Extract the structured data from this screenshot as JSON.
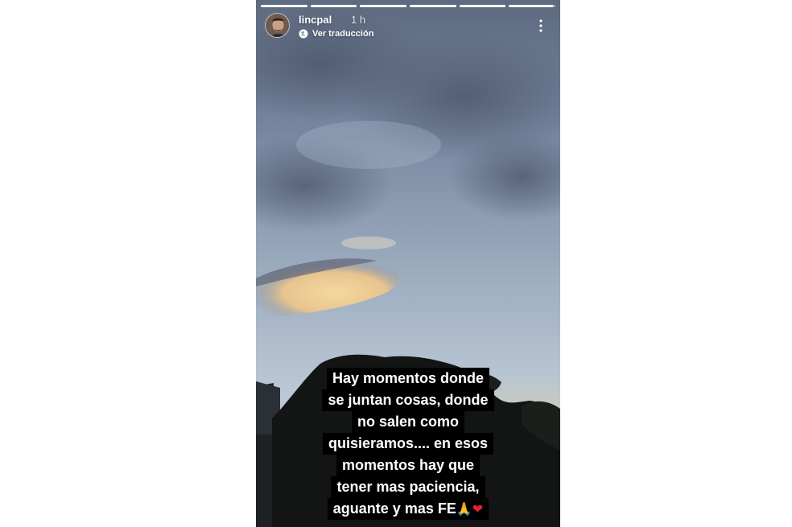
{
  "story": {
    "username": "lincpal",
    "time": "1 h",
    "translate_label": "Ver traducción",
    "progress": [
      1,
      1,
      1,
      1,
      1,
      0.95
    ],
    "caption_lines": [
      "Hay momentos donde",
      "se juntan cosas, donde",
      "no salen como",
      "quisieramos.... en esos",
      "momentos hay que",
      "tener mas paciencia,",
      "aguante y mas FE"
    ],
    "caption_emojis": [
      "🙏",
      "❤"
    ],
    "icons": {
      "translate": "translate-icon",
      "more": "more-options-icon"
    },
    "colors": {
      "caption_bg": "#000000",
      "caption_text": "#ffffff",
      "heart": "#e0242c"
    }
  }
}
